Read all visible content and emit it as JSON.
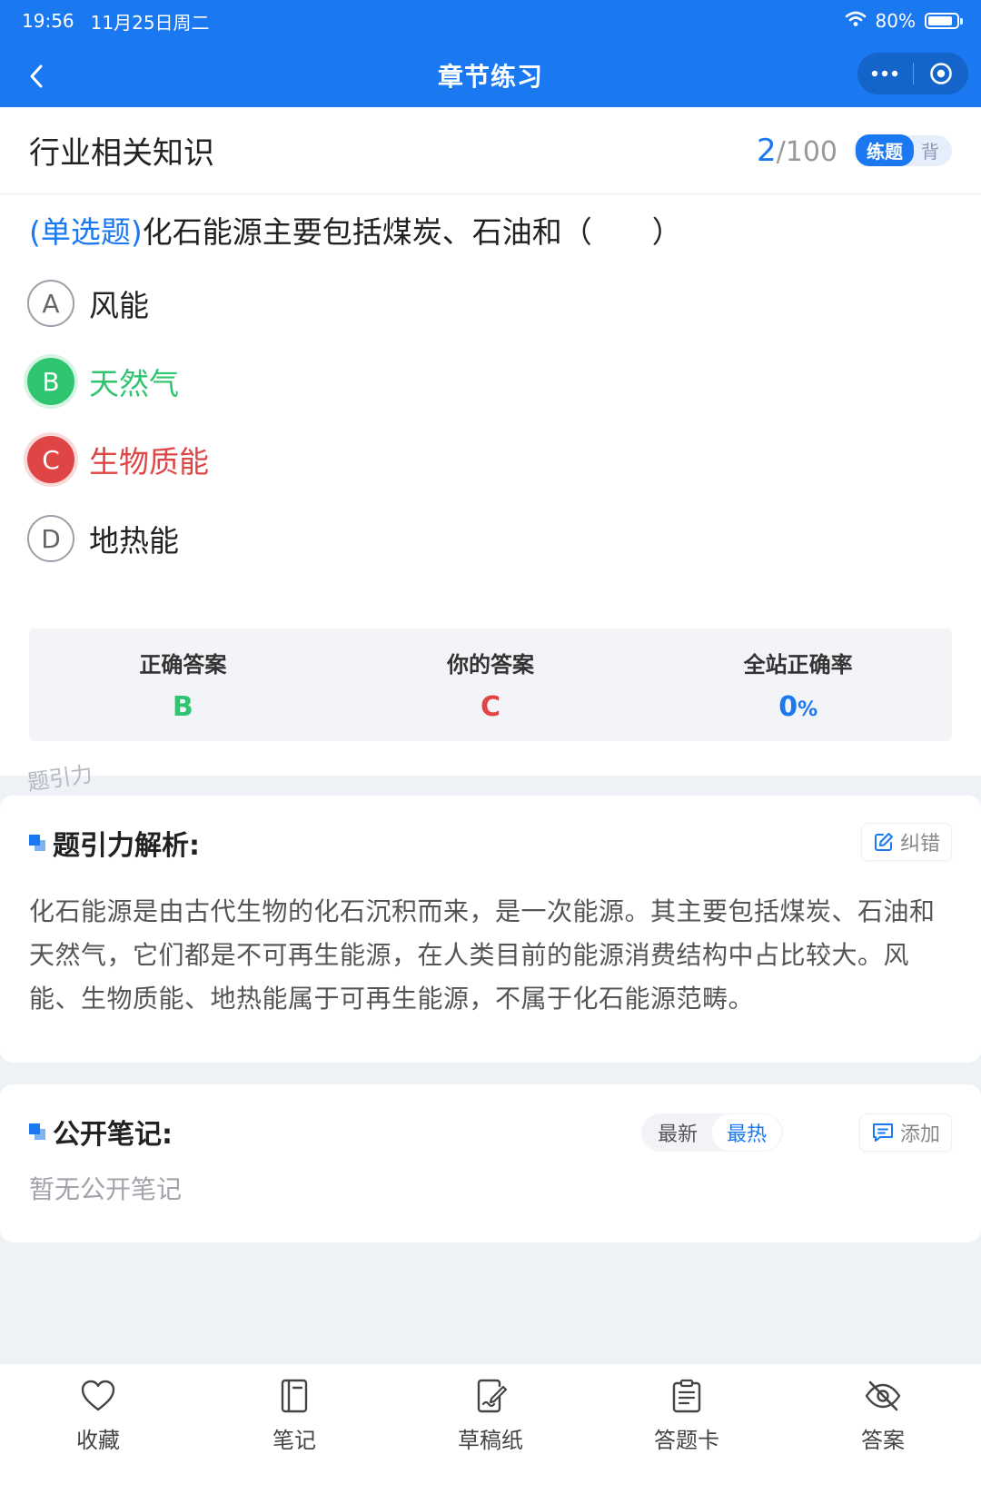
{
  "status_bar": {
    "time": "19:56",
    "date": "11月25日周二",
    "battery": "80%"
  },
  "nav": {
    "title": "章节练习"
  },
  "header": {
    "section_name": "行业相关知识",
    "current": "2",
    "total": "/100",
    "mode_active": "练题",
    "mode_inactive": "背"
  },
  "question": {
    "type": "(单选题)",
    "text": "化石能源主要包括煤炭、石油和（　　）",
    "options": [
      {
        "letter": "A",
        "text": "风能",
        "state": "normal"
      },
      {
        "letter": "B",
        "text": "天然气",
        "state": "correct"
      },
      {
        "letter": "C",
        "text": "生物质能",
        "state": "wrong"
      },
      {
        "letter": "D",
        "text": "地热能",
        "state": "normal"
      }
    ]
  },
  "answers": {
    "correct_label": "正确答案",
    "correct_value": "B",
    "yours_label": "你的答案",
    "yours_value": "C",
    "rate_label": "全站正确率",
    "rate_value": "0",
    "rate_unit": "%"
  },
  "watermark": "题引力",
  "analysis": {
    "title": "题引力解析:",
    "correct_button": "纠错",
    "text": "化石能源是由古代生物的化石沉积而来，是一次能源。其主要包括煤炭、石油和天然气，它们都是不可再生能源，在人类目前的能源消费结构中占比较大。风能、生物质能、地热能属于可再生能源，不属于化石能源范畴。"
  },
  "notes": {
    "title": "公开笔记:",
    "sort_newest": "最新",
    "sort_hottest": "最热",
    "add_button": "添加",
    "empty": "暂无公开笔记"
  },
  "bottom_tabs": [
    {
      "label": "收藏",
      "icon": "heart-icon"
    },
    {
      "label": "笔记",
      "icon": "notebook-icon"
    },
    {
      "label": "草稿纸",
      "icon": "draft-icon"
    },
    {
      "label": "答题卡",
      "icon": "answer-sheet-icon"
    },
    {
      "label": "答案",
      "icon": "eye-off-icon"
    }
  ],
  "colors": {
    "brand": "#1a78f0",
    "correct": "#2fc46f",
    "wrong": "#e04545"
  }
}
